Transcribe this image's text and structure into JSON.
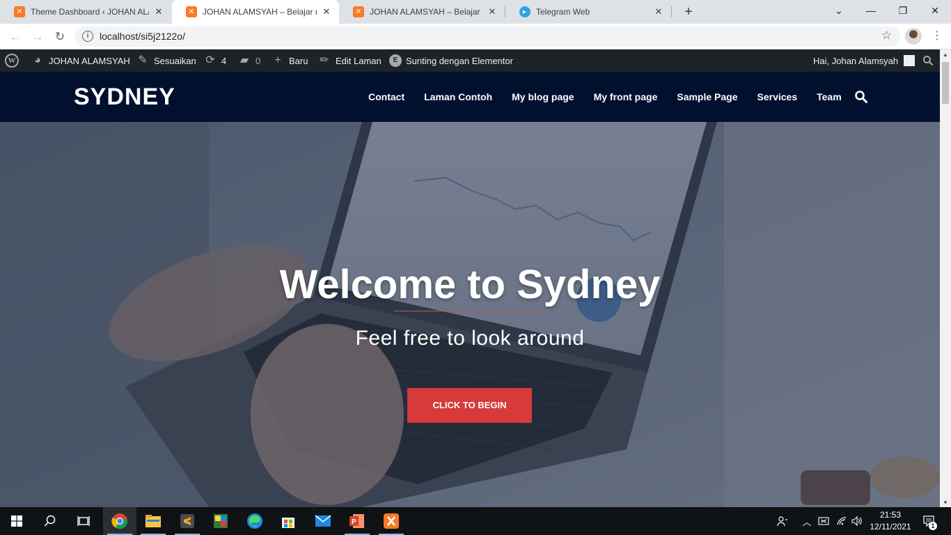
{
  "browser": {
    "tabs": [
      {
        "title": "Theme Dashboard ‹ JOHAN ALAMSYAH",
        "favicon": "xampp-icon",
        "active": false
      },
      {
        "title": "JOHAN ALAMSYAH – Belajar mar",
        "favicon": "xampp-icon",
        "active": true
      },
      {
        "title": "JOHAN ALAMSYAH – Belajar mar",
        "favicon": "xampp-icon",
        "active": false
      },
      {
        "title": "Telegram Web",
        "favicon": "telegram-icon",
        "active": false
      }
    ],
    "url": "localhost/si5j2122o/"
  },
  "adminbar": {
    "site_name": "JOHAN ALAMSYAH",
    "customize": "Sesuaikan",
    "updates_count": "4",
    "comments_count": "0",
    "new_label": "Baru",
    "edit_page": "Edit Laman",
    "elementor": "Sunting dengan Elementor",
    "greeting": "Hai, Johan Alamsyah"
  },
  "site": {
    "logo": "SYDNEY",
    "nav": [
      "Contact",
      "Laman Contoh",
      "My blog page",
      "My front page",
      "Sample Page",
      "Services",
      "Team"
    ]
  },
  "hero": {
    "title": "Welcome to Sydney",
    "subtitle": "Feel free to look around",
    "button": "Click to begin"
  },
  "taskbar": {
    "apps": [
      "windows-start-icon",
      "search-icon",
      "task-view-icon",
      "chrome-icon",
      "file-explorer-icon",
      "sublime-text-icon",
      "game-icon",
      "edge-icon",
      "store-icon",
      "mail-icon",
      "powerpoint-icon",
      "xampp-icon"
    ],
    "time": "21:53",
    "date": "12/11/2021",
    "notification_count": "1"
  },
  "colors": {
    "header_bg": "#00102e",
    "adminbar_bg": "#1d2327",
    "accent": "#d63a3a"
  }
}
